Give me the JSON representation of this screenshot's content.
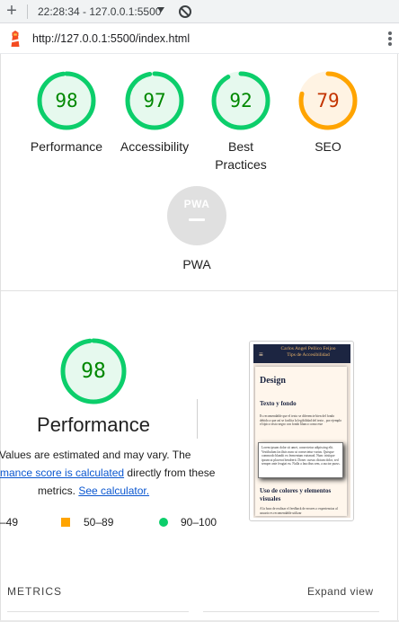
{
  "browser": {
    "new_tab_icon": "plus-icon",
    "tab_title": "22:28:34 - 127.0.0.1:5500",
    "url": "http://127.0.0.1:5500/index.html"
  },
  "summary": {
    "categories": [
      {
        "label": "Performance",
        "score": "98",
        "fraction": 0.98,
        "rating": "pass"
      },
      {
        "label": "Accessibility",
        "score": "97",
        "fraction": 0.97,
        "rating": "pass"
      },
      {
        "label": "Best Practices",
        "score": "92",
        "fraction": 0.92,
        "rating": "pass"
      },
      {
        "label": "SEO",
        "score": "79",
        "fraction": 0.79,
        "rating": "average"
      }
    ],
    "pwa": {
      "badge": "PWA",
      "label": "PWA"
    }
  },
  "colors": {
    "pass": "#0cce6b",
    "pass_bg": "#e6f9ee",
    "pass_text": "#008800",
    "average": "#ffa400",
    "average_bg": "#fff3e3",
    "average_text": "#c33300",
    "track": "#e0e0e0",
    "link": "#0b57d0"
  },
  "performance": {
    "score": "98",
    "fraction": 0.98,
    "title": "Performance",
    "note_line1": "Values are estimated and may vary. The",
    "note_link1": "mance score is calculated",
    "note_line2_rest": " directly from these",
    "note_line3": "metrics. ",
    "note_link2": "See calculator.",
    "legend": {
      "fail": "–49",
      "average": "50–89",
      "pass": "90–100"
    }
  },
  "thumbnail": {
    "brand_line1": "Carlos Angel Pellico Feijoo",
    "brand_line2": "Tips de Accesibilidad",
    "heading": "Design",
    "subheading1": "Texto y fondo",
    "para1": "Es recomendable que el texto se diferencie bien del fondo debido a que así se facilita la legibilidad del texto , por ejemplo el típico texto negro con fondo blanco como este",
    "box_text": "Lorem ipsum dolor sit amet, consectetur adipiscing elit. Vestibulum facilisis nunc ut consectetur varius. Quisque commodo blandit ex fermentum euismod. Nunc tristique ipsum ut placerat hendrerit. Donec cursus dictum dolor, sed semper ante feugiat eu. Nulla a faucibus sem, a auctor purus.",
    "subheading2": "Uso de colores y elementos visuales",
    "para2": "A la hora de realizar el feedback de errores o experiencias al usuario es recomendable utilizar"
  },
  "metrics": {
    "label": "METRICS",
    "expand": "Expand view"
  }
}
